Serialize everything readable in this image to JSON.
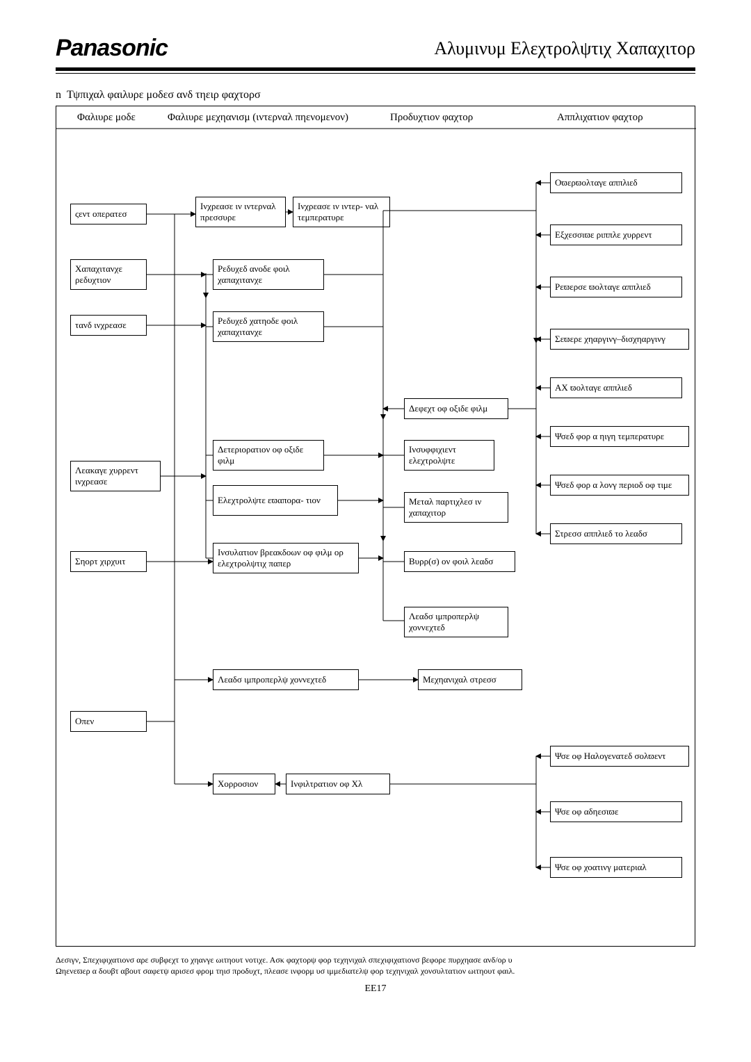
{
  "brand": "Panasonic",
  "title": "Αλυμινυμ Ελεχτρολψτιχ Χαπαχιτορ",
  "subtitle_prefix": "n",
  "subtitle": "Τψπιχαλ φαιλυρε μοδεσ ανδ τηειρ φαχτορσ",
  "headers": {
    "mode": "Φαλιυρε μοδε",
    "mechanism": "Φαλιυρε μεχηανισμ (ιντερναλ πηενομενον)",
    "production": "Προδυχτιον φαχτορ",
    "application": "Αππλιχατιον φαχτορ"
  },
  "mode": {
    "vent": "ςεντ οπερατεσ",
    "cap_red": "Χαπαχιτανχε ρεδυχτιον",
    "tand": "τανδ ινχρεασε",
    "leak": "Λεακαγε χυρρεντ ινχρεασε",
    "short": "Σηορτ χιρχυιτ",
    "open": "Οπεν"
  },
  "mech": {
    "inc_press": "Ινχρεασε ιν ιντερναλ πρεσσυρε",
    "inc_temp": "Ινχρεασε ιν ιντερ- ναλ τεμπερατυρε",
    "red_anode": "Ρεδυχεδ ανοδε φοιλ χαπαχιτανχε",
    "red_cath": "Ρεδυχεδ χατηοδε φοιλ χαπαχιτανχε",
    "det_oxide": "Δετεριορατιον οφ οξιδε φιλμ",
    "evap": "Ελεχτρολψτε εϖαπορα- τιον",
    "insul": "Ινσυλατιον βρεακδοων οφ φιλμ ορ ελεχτρολψτιχ παπερ",
    "leads_imp2": "Λεαδσ ιμπροπερλψ χοννεχτεδ",
    "corr": "Χορροσιον",
    "infil": "Ινφιλτρατιον οφ Χλ"
  },
  "prod": {
    "defect": "Δεφεχτ οφ οξιδε φιλμ",
    "insuff": "Ινσυφφιχιεντ ελεχτρολψτε",
    "metal": "Μεταλ παρτιχλεσ ιν χαπαχιτορ",
    "burr": "Βυρρ(σ) ον φοιλ λεαδσ",
    "leads_imp": "Λεαδσ ιμπροπερλψ χοννεχτεδ",
    "mstress": "Μεχηανιχαλ στρεσσ"
  },
  "app": {
    "over": "Οϖερϖολταγε αππλιεδ",
    "ripple": "Εξχεσσιϖε ριππλε χυρρεντ",
    "rev": "Ρεϖερσε ϖολταγε αππλιεδ",
    "sev": "Σεϖερε χηαργινγ–δισχηαργινγ",
    "ac": "ΑΧ ϖολταγε αππλιεδ",
    "htemp": "Ψσεδ φορ α ηιγη τεμπερατυρε",
    "long": "Ψσεδ φορ α λονγ περιοδ οφ τιμε",
    "stress": "Στρεσσ αππλιεδ το λεαδσ",
    "halog": "Ψσε οφ Ηαλογενατεδ σολϖεντ",
    "adh": "Ψσε οφ αδηεσιϖε",
    "coat": "Ψσε οφ χοατινγ ματεριαλ"
  },
  "footer1": "Δεσιγν, Σπεχιφιχατιονσ αρε συβφεχτ το χηανγε ωιτηουτ νοτιχε.  Ασκ φαχτορψ φορ τεχηνιχαλ σπεχιφιχατιονσ βεφορε πυρχηασε ανδ/ορ υ",
  "footer2": "Ωηενεϖερ α δουβτ αβουτ σαφετψ αρισεσ φρομ τηισ προδυχτ, πλεασε ινφορμ υσ ιμμεδιατελψ φορ τεχηνιχαλ χονσυλτατιον ωιτηουτ φαιλ.",
  "pageno": "EE17"
}
